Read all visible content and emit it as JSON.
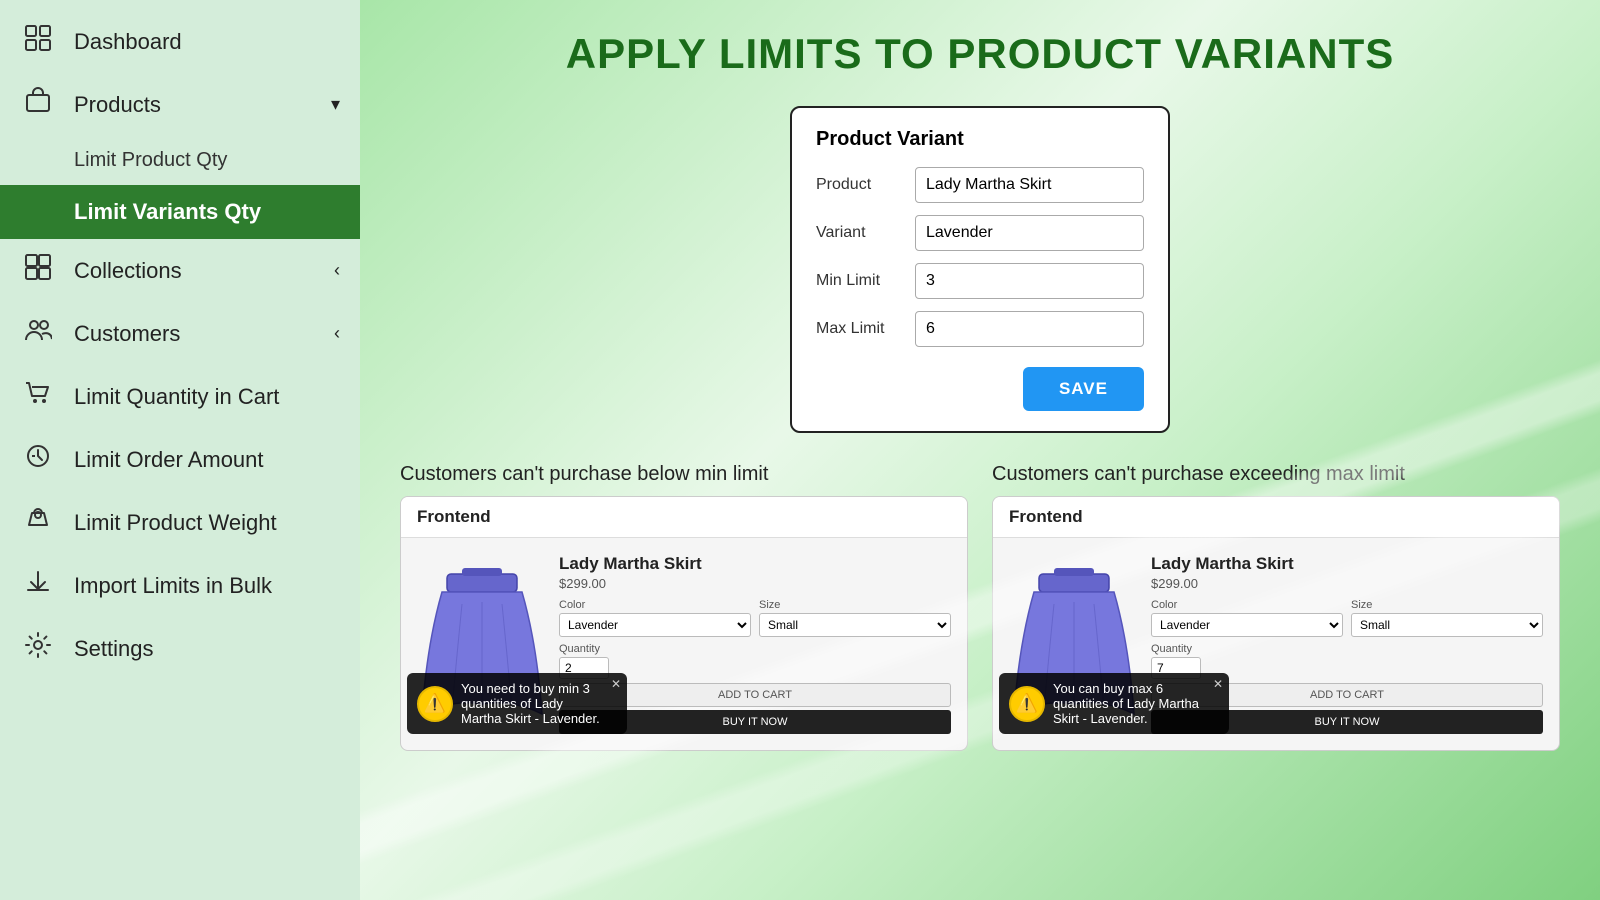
{
  "sidebar": {
    "items": [
      {
        "id": "dashboard",
        "label": "Dashboard",
        "icon": "⊞",
        "active": false,
        "hasChevron": false
      },
      {
        "id": "products",
        "label": "Products",
        "icon": "📦",
        "active": false,
        "hasChevron": true,
        "chevronDir": "down"
      },
      {
        "id": "limit-product-qty",
        "label": "Limit Product Qty",
        "icon": "",
        "active": false,
        "isSub": true
      },
      {
        "id": "limit-variants-qty",
        "label": "Limit Variants Qty",
        "icon": "",
        "active": true,
        "isSub": true
      },
      {
        "id": "collections",
        "label": "Collections",
        "icon": "⊟",
        "active": false,
        "hasChevron": true,
        "chevronDir": "left"
      },
      {
        "id": "customers",
        "label": "Customers",
        "icon": "👥",
        "active": false,
        "hasChevron": true,
        "chevronDir": "left"
      },
      {
        "id": "limit-quantity-cart",
        "label": "Limit Quantity in Cart",
        "icon": "🛒",
        "active": false
      },
      {
        "id": "limit-order-amount",
        "label": "Limit Order Amount",
        "icon": "🛒",
        "active": false
      },
      {
        "id": "limit-product-weight",
        "label": "Limit Product Weight",
        "icon": "⚙",
        "active": false
      },
      {
        "id": "import-limits",
        "label": "Import Limits in Bulk",
        "icon": "⬇",
        "active": false
      },
      {
        "id": "settings",
        "label": "Settings",
        "icon": "⚙",
        "active": false
      }
    ]
  },
  "page": {
    "title": "APPLY LIMITS TO PRODUCT VARIANTS"
  },
  "variant_form": {
    "title": "Product Variant",
    "product_label": "Product",
    "product_value": "Lady Martha Skirt",
    "variant_label": "Variant",
    "variant_value": "Lavender",
    "min_limit_label": "Min Limit",
    "min_limit_value": "3",
    "max_limit_label": "Max Limit",
    "max_limit_value": "6",
    "save_button": "SAVE"
  },
  "preview": {
    "left_caption": "Customers can't purchase below min limit",
    "right_caption": "Customers can't purchase exceeding max limit",
    "frontend_label": "Frontend",
    "product_name": "Lady Martha Skirt",
    "product_price": "$299.00",
    "color_label": "Color",
    "color_value": "Lavender",
    "size_label": "Size",
    "size_value": "Small",
    "quantity_label": "Quantity",
    "left_qty": "2",
    "right_qty": "7",
    "add_to_cart": "ADD TO CART",
    "buy_it_now": "BUY IT NOW",
    "left_toast": "You need to buy min 3 quantities of Lady Martha Skirt - Lavender.",
    "right_toast": "You can buy max 6 quantities of Lady Martha Skirt - Lavender."
  }
}
